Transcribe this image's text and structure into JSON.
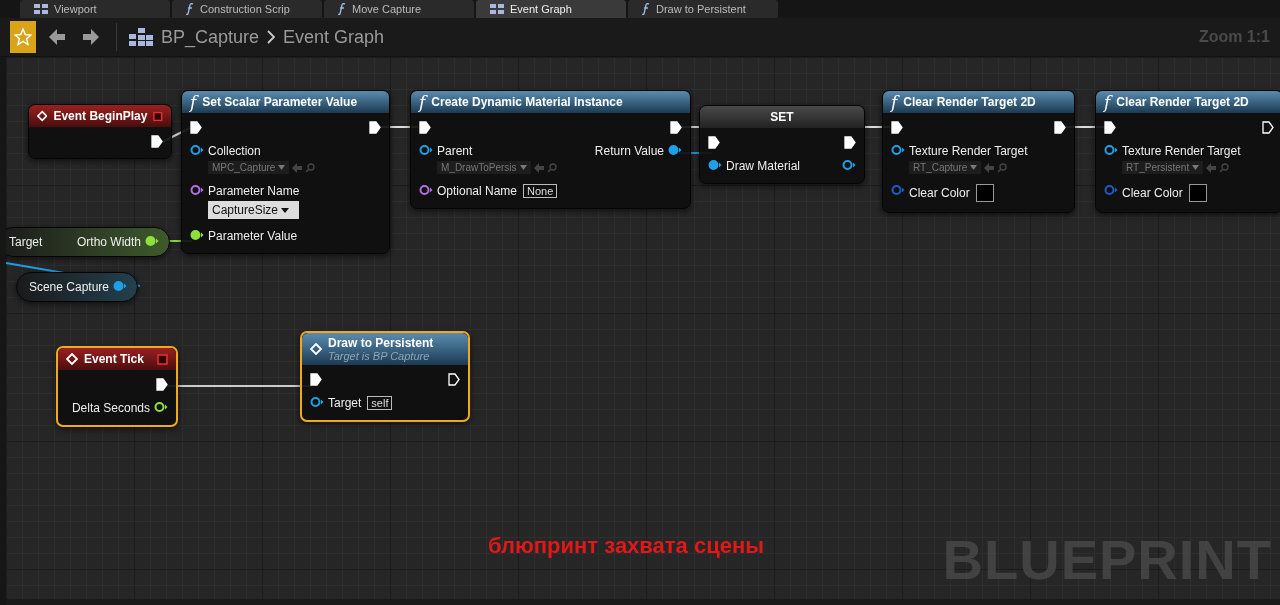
{
  "tabs": [
    {
      "label": "Viewport",
      "kind": "viewport",
      "selected": false
    },
    {
      "label": "Construction Scrip",
      "kind": "function",
      "selected": false
    },
    {
      "label": "Move Capture",
      "kind": "function",
      "selected": false
    },
    {
      "label": "Event Graph",
      "kind": "viewport",
      "selected": true
    },
    {
      "label": "Draw to Persistent",
      "kind": "function",
      "selected": false
    }
  ],
  "toolbar": {
    "blueprint": "BP_Capture",
    "graph": "Event Graph",
    "zoom": "Zoom 1:1"
  },
  "nodes": [
    {
      "kind": "event",
      "title": "Event BeginPlay",
      "selected": false,
      "rows": [
        {
          "right": {
            "kind": "exec",
            "connected": true
          }
        }
      ]
    },
    {
      "kind": "function",
      "glyph": "f",
      "title": "Set Scalar Parameter Value",
      "selected": false,
      "rows": [
        {
          "left": {
            "kind": "exec",
            "connected": true
          },
          "right": {
            "kind": "exec",
            "connected": true
          }
        },
        {
          "left": {
            "kind": "data",
            "label": "Collection",
            "color": "#1ea0e6",
            "connected": false,
            "field": {
              "kind": "asset",
              "value": "MPC_Capture"
            }
          }
        },
        {
          "left": {
            "kind": "data",
            "label": "Parameter Name",
            "color": "#b46ee6",
            "connected": false,
            "field": {
              "kind": "combo",
              "value": "CaptureSize"
            }
          }
        },
        {
          "left": {
            "kind": "data",
            "label": "Parameter Value",
            "color": "#8ee03c",
            "connected": true
          }
        }
      ]
    },
    {
      "kind": "function",
      "glyph": "f",
      "title": "Create Dynamic Material Instance",
      "selected": false,
      "rows": [
        {
          "left": {
            "kind": "exec",
            "connected": true
          },
          "right": {
            "kind": "exec",
            "connected": true
          }
        },
        {
          "left": {
            "kind": "data",
            "label": "Parent",
            "color": "#1ea0e6",
            "connected": false,
            "field": {
              "kind": "asset",
              "value": "M_DrawToPersis"
            }
          },
          "right": {
            "kind": "data",
            "label": "Return Value",
            "color": "#1ea0e6",
            "connected": true
          }
        },
        {
          "left": {
            "kind": "data",
            "label": "Optional Name",
            "color": "#b46ee6",
            "connected": false,
            "field": {
              "kind": "name",
              "value": "None"
            }
          }
        }
      ]
    },
    {
      "kind": "set",
      "title": "SET",
      "selected": false,
      "rows": [
        {
          "left": {
            "kind": "exec",
            "connected": true
          },
          "right": {
            "kind": "exec",
            "connected": true
          }
        },
        {
          "left": {
            "kind": "data",
            "label": "Draw Material",
            "color": "#1ea0e6",
            "connected": true
          },
          "right": {
            "kind": "data",
            "color": "#1ea0e6",
            "connected": false
          }
        }
      ]
    },
    {
      "kind": "function",
      "glyph": "f",
      "title": "Clear Render Target 2D",
      "selected": false,
      "rows": [
        {
          "left": {
            "kind": "exec",
            "connected": true
          },
          "right": {
            "kind": "exec",
            "connected": true
          }
        },
        {
          "left": {
            "kind": "data",
            "label": "Texture Render Target",
            "color": "#1ea0e6",
            "connected": false,
            "field": {
              "kind": "asset",
              "value": "RT_Capture"
            }
          }
        },
        {
          "left": {
            "kind": "data",
            "label": "Clear Color",
            "color": "#1e5ac8",
            "connected": false,
            "field": {
              "kind": "swatch",
              "color": "#000000"
            }
          }
        }
      ]
    },
    {
      "kind": "function",
      "glyph": "f",
      "title": "Clear Render Target 2D",
      "selected": false,
      "rows": [
        {
          "left": {
            "kind": "exec",
            "connected": true
          },
          "right": {
            "kind": "exec",
            "connected": false
          }
        },
        {
          "left": {
            "kind": "data",
            "label": "Texture Render Target",
            "color": "#1ea0e6",
            "connected": false,
            "field": {
              "kind": "asset",
              "value": "RT_Persistent"
            }
          }
        },
        {
          "left": {
            "kind": "data",
            "label": "Clear Color",
            "color": "#1e5ac8",
            "connected": false,
            "field": {
              "kind": "swatch",
              "color": "#000000"
            }
          }
        }
      ]
    },
    {
      "kind": "getter",
      "color": "#3e5a2c",
      "selected": false,
      "rows": [
        {
          "left": {
            "kind": "label",
            "label": "Target"
          },
          "right": {
            "kind": "data",
            "label": "Ortho Width",
            "color": "#8ee03c",
            "connected": true
          }
        }
      ]
    },
    {
      "kind": "getter",
      "color": "#23404e",
      "selected": false,
      "rows": [
        {
          "right": {
            "kind": "data",
            "label": "Scene Capture",
            "color": "#1ea0e6",
            "connected": true
          }
        }
      ]
    },
    {
      "kind": "event",
      "title": "Event Tick",
      "selected": true,
      "rows": [
        {
          "right": {
            "kind": "exec",
            "connected": true
          }
        },
        {
          "right": {
            "kind": "data",
            "label": "Delta Seconds",
            "color": "#8ee03c",
            "connected": false
          }
        }
      ]
    },
    {
      "kind": "call",
      "title": "Draw to Persistent",
      "subtitle": "Target is BP Capture",
      "selected": true,
      "rows": [
        {
          "left": {
            "kind": "exec",
            "connected": true
          },
          "right": {
            "kind": "exec",
            "connected": false
          }
        },
        {
          "left": {
            "kind": "data",
            "label": "Target",
            "color": "#1ea0e6",
            "connected": false,
            "field": {
              "kind": "name",
              "value": "self"
            }
          }
        }
      ]
    }
  ],
  "watermark": "BLUEPRINT",
  "caption": "блюпринт захвата сцены"
}
